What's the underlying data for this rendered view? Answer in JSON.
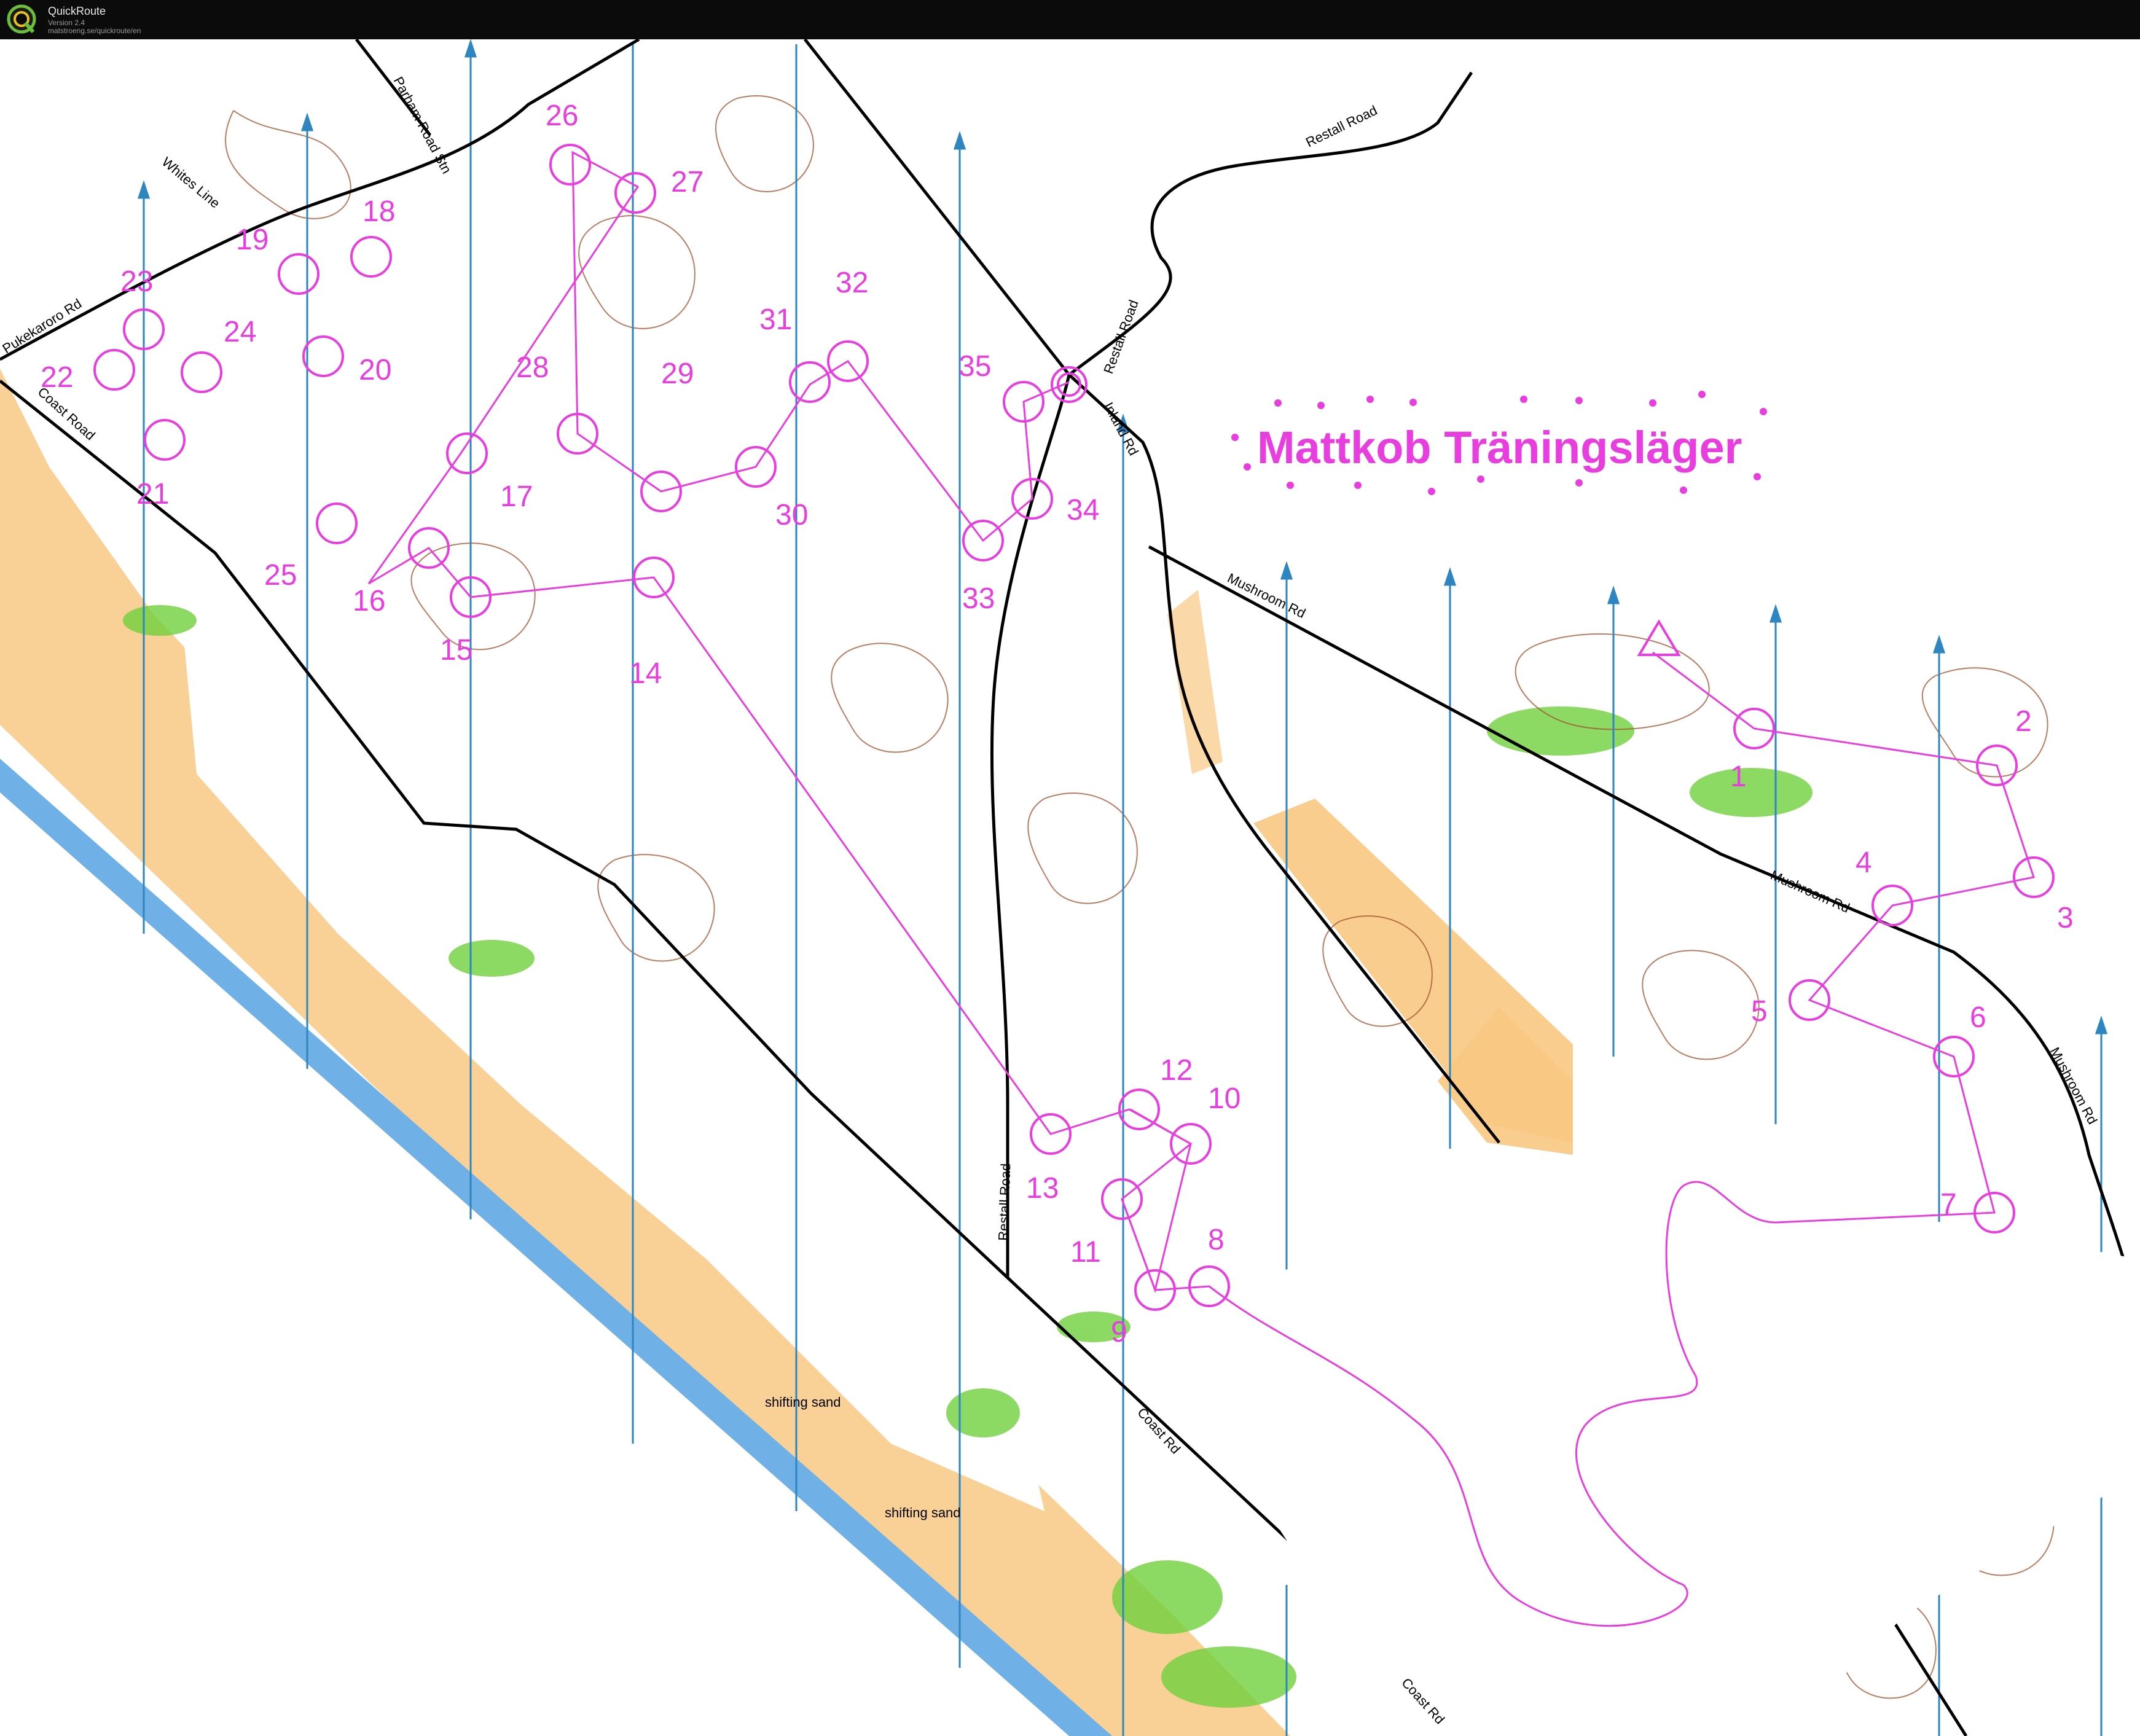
{
  "app": {
    "name": "QuickRoute",
    "version": "Version 2.4",
    "url": "matstroeng.se/quickroute/en"
  },
  "map": {
    "title": "Mattkob Träningsläger",
    "course_color": "#e83ee0",
    "north_line_color": "#2e86c1",
    "road_color": "#000000",
    "contour_color": "#a0522d",
    "sea_color": "#6fb0e6",
    "open_land_color": "#f8c882",
    "vegetation_color": "#6fd03c",
    "road_labels": [
      "Parham Road Stn",
      "Whites Line",
      "Pukekaroro Rd",
      "Coast Road",
      "Restall Road",
      "Restall Road",
      "Inland Rd",
      "Mushroom Rd",
      "Mushroom Rd",
      "Mushroom Rd",
      "Restall Road",
      "Coast Rd",
      "Coast Rd"
    ],
    "terrain_labels": [
      "shifting sand",
      "shifting sand"
    ],
    "controls": [
      {
        "label": "1"
      },
      {
        "label": "2"
      },
      {
        "label": "3"
      },
      {
        "label": "4"
      },
      {
        "label": "5"
      },
      {
        "label": "6"
      },
      {
        "label": "7"
      },
      {
        "label": "8"
      },
      {
        "label": "9"
      },
      {
        "label": "10"
      },
      {
        "label": "11"
      },
      {
        "label": "12"
      },
      {
        "label": "13"
      },
      {
        "label": "14"
      },
      {
        "label": "15"
      },
      {
        "label": "16"
      },
      {
        "label": "17"
      },
      {
        "label": "18"
      },
      {
        "label": "19"
      },
      {
        "label": "20"
      },
      {
        "label": "21"
      },
      {
        "label": "22"
      },
      {
        "label": "23"
      },
      {
        "label": "24"
      },
      {
        "label": "25"
      },
      {
        "label": "26"
      },
      {
        "label": "27"
      },
      {
        "label": "28"
      },
      {
        "label": "29"
      },
      {
        "label": "30"
      },
      {
        "label": "31"
      },
      {
        "label": "32"
      },
      {
        "label": "33"
      },
      {
        "label": "34"
      },
      {
        "label": "35"
      }
    ]
  }
}
